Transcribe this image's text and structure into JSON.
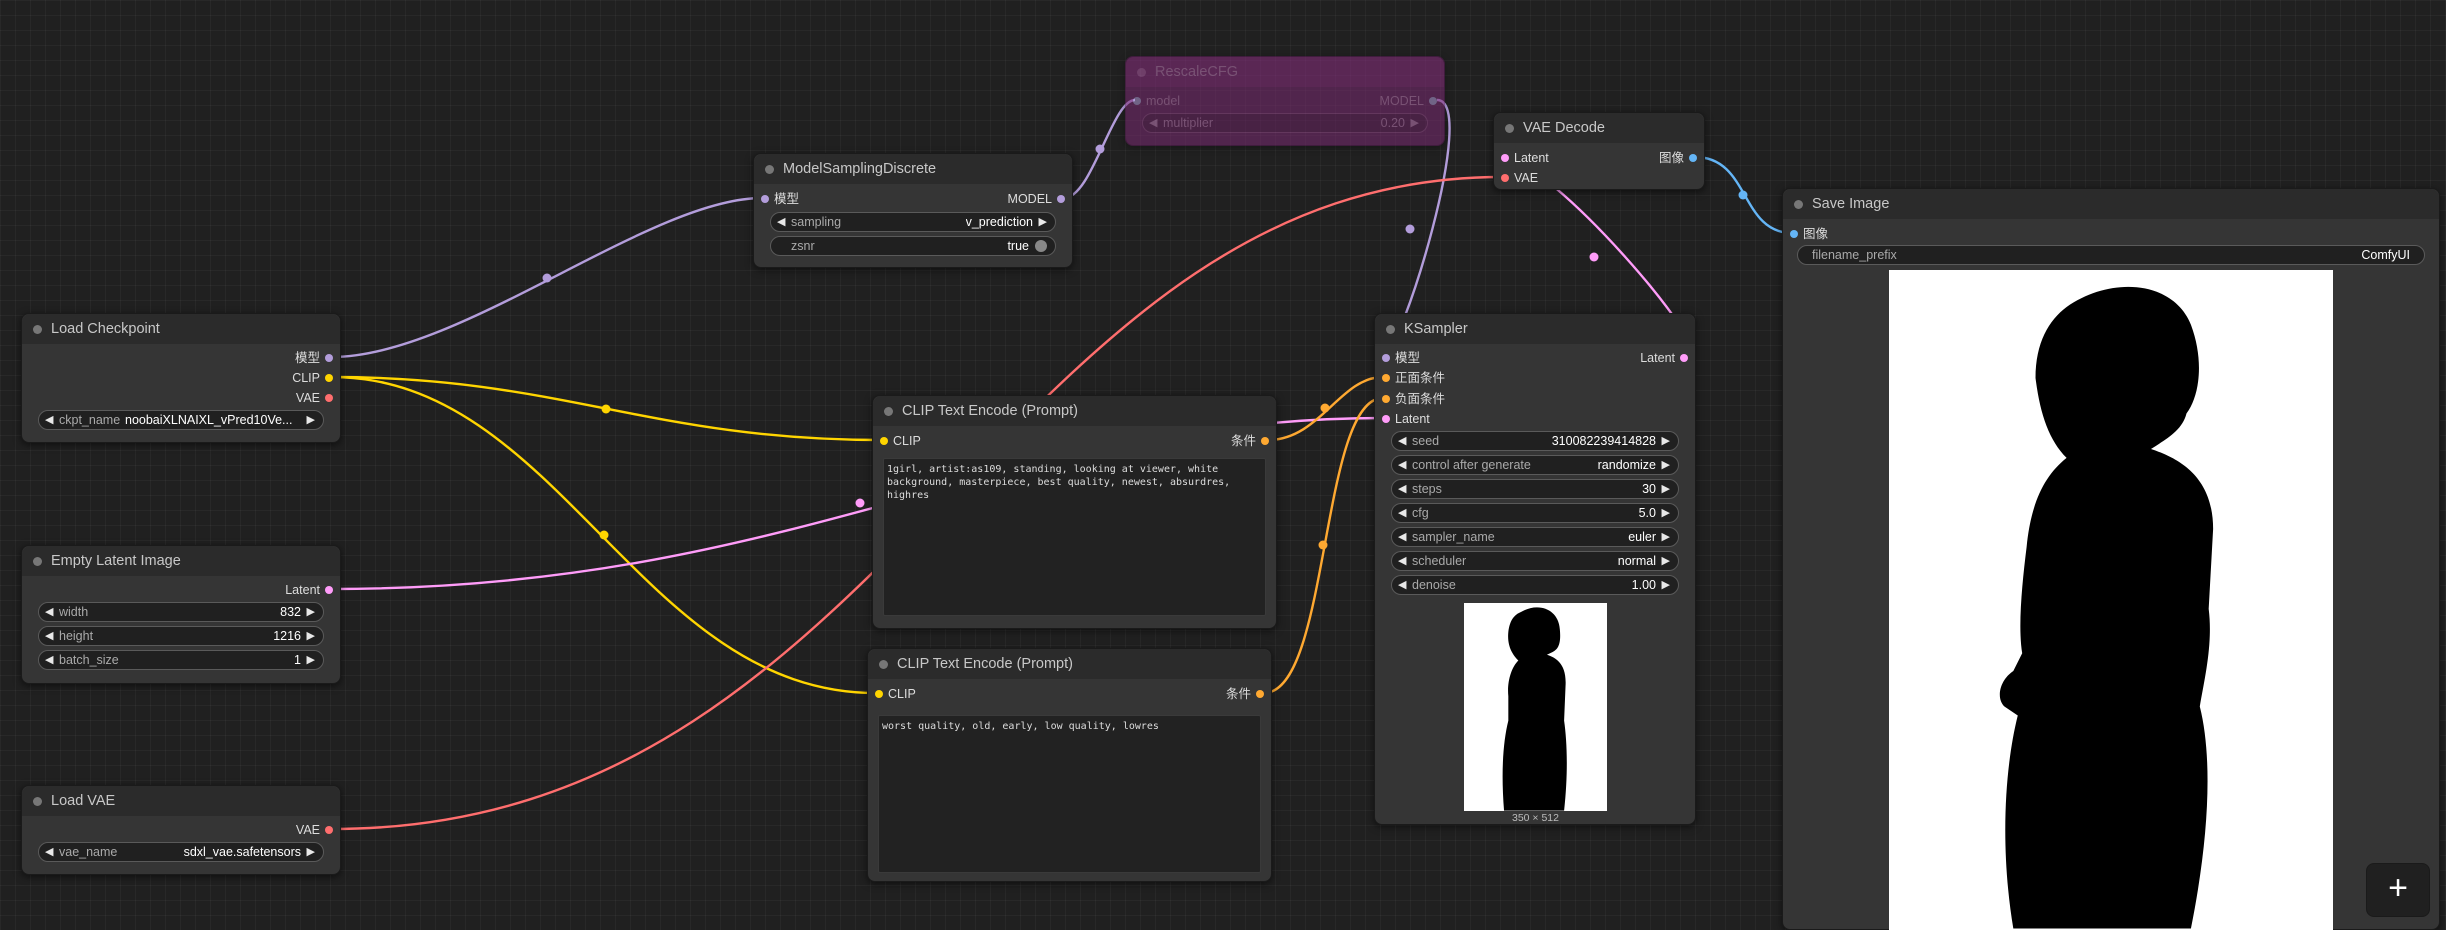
{
  "colors": {
    "model": "#b39ddb",
    "clip": "#ffd500",
    "conditioning": "#ffa931",
    "latent": "#ff9cf9",
    "vae": "#ff6e6e",
    "image": "#64b5f6",
    "node_bg": "#353535",
    "bypassed_node": "#7a2a72"
  },
  "nodes": {
    "load_checkpoint": {
      "title": "Load Checkpoint",
      "outputs": [
        "模型",
        "CLIP",
        "VAE"
      ],
      "ckpt_name_label": "ckpt_name",
      "ckpt_name_value": "noobaiXLNAIXL_vPred10Ve..."
    },
    "empty_latent": {
      "title": "Empty Latent Image",
      "output": "Latent",
      "widgets": [
        {
          "name": "width",
          "value": "832"
        },
        {
          "name": "height",
          "value": "1216"
        },
        {
          "name": "batch_size",
          "value": "1"
        }
      ]
    },
    "load_vae": {
      "title": "Load VAE",
      "output": "VAE",
      "vae_name_label": "vae_name",
      "vae_name_value": "sdxl_vae.safetensors"
    },
    "model_sampling": {
      "title": "ModelSamplingDiscrete",
      "input": "模型",
      "output": "MODEL",
      "sampling_label": "sampling",
      "sampling_value": "v_prediction",
      "zsnr_label": "zsnr",
      "zsnr_value": "true"
    },
    "rescale_cfg": {
      "title": "RescaleCFG",
      "input": "model",
      "output": "MODEL",
      "multiplier_label": "multiplier",
      "multiplier_value": "0.20"
    },
    "clip_pos": {
      "title": "CLIP Text Encode (Prompt)",
      "input": "CLIP",
      "output": "条件",
      "text": "1girl, artist:as109, standing, looking at viewer, white background, masterpiece, best quality, newest, absurdres, highres"
    },
    "clip_neg": {
      "title": "CLIP Text Encode (Prompt)",
      "input": "CLIP",
      "output": "条件",
      "text": "worst quality, old, early, low quality, lowres"
    },
    "ksampler": {
      "title": "KSampler",
      "inputs": [
        "模型",
        "正面条件",
        "负面条件",
        "Latent"
      ],
      "output": "Latent",
      "widgets": [
        {
          "name": "seed",
          "value": "310082239414828"
        },
        {
          "name": "control after generate",
          "value": "randomize"
        },
        {
          "name": "steps",
          "value": "30"
        },
        {
          "name": "cfg",
          "value": "5.0"
        },
        {
          "name": "sampler_name",
          "value": "euler"
        },
        {
          "name": "scheduler",
          "value": "normal"
        },
        {
          "name": "denoise",
          "value": "1.00"
        }
      ],
      "preview_caption": "350 × 512"
    },
    "vae_decode": {
      "title": "VAE Decode",
      "inputs": [
        "Latent",
        "VAE"
      ],
      "output": "图像"
    },
    "save_image": {
      "title": "Save Image",
      "input": "图像",
      "filename_prefix_label": "filename_prefix",
      "filename_prefix_value": "ComfyUI"
    }
  },
  "fab_label": "+"
}
